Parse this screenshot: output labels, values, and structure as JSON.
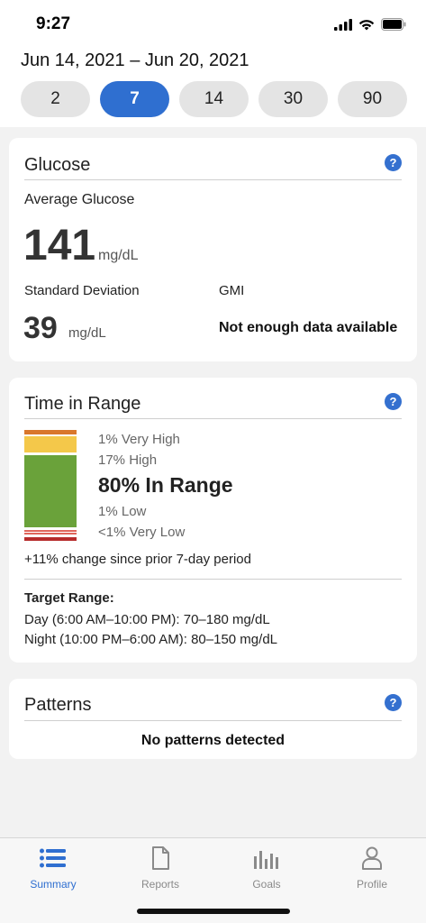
{
  "status": {
    "time": "9:27"
  },
  "header": {
    "date_range": "Jun 14, 2021 – Jun 20, 2021",
    "range_options": [
      "2",
      "7",
      "14",
      "30",
      "90"
    ],
    "selected_range": "7"
  },
  "glucose": {
    "title": "Glucose",
    "help": "?",
    "avg_label": "Average Glucose",
    "avg_value": "141",
    "avg_unit": "mg/dL",
    "sd_label": "Standard Deviation",
    "sd_value": "39",
    "sd_unit": "mg/dL",
    "gmi_label": "GMI",
    "gmi_value": "Not enough data available"
  },
  "time_in_range": {
    "title": "Time in Range",
    "help": "?",
    "very_high": "1% Very High",
    "high": "17% High",
    "in_range": "80% In Range",
    "low": "1% Low",
    "very_low": "<1% Very Low",
    "change": "+11% change since prior 7-day period",
    "target_title": "Target Range:",
    "target_day": "Day (6:00 AM–10:00 PM): 70–180 mg/dL",
    "target_night": "Night (10:00 PM–6:00 AM): 80–150 mg/dL",
    "colors": {
      "very_high": "#d9772c",
      "high": "#f4c84a",
      "in_range": "#6aa23a",
      "low": "#e0665c",
      "very_low": "#b62c2c"
    }
  },
  "patterns": {
    "title": "Patterns",
    "help": "?",
    "empty_text": "No patterns detected"
  },
  "tabs": [
    {
      "label": "Summary",
      "icon": "list-icon"
    },
    {
      "label": "Reports",
      "icon": "document-icon"
    },
    {
      "label": "Goals",
      "icon": "bar-chart-icon"
    },
    {
      "label": "Profile",
      "icon": "person-icon"
    }
  ],
  "active_tab": "Summary",
  "accent_color": "#2f6fd0"
}
